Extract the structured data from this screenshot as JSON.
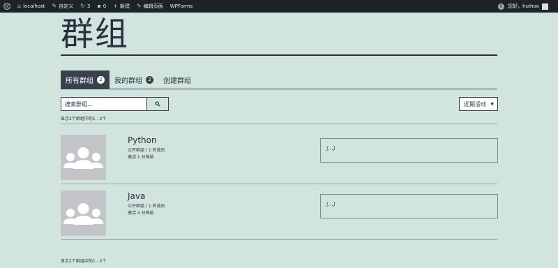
{
  "adminbar": {
    "site_name": "localhost",
    "customize": "自定义",
    "updates_count": "3",
    "comments_count": "0",
    "new": "新建",
    "edit_page": "编辑页面",
    "wpforms": "WPForms",
    "notifications": "0",
    "greeting": "您好，huihoo"
  },
  "page": {
    "title": "群组"
  },
  "tabs": [
    {
      "label": "所有群组",
      "count": "2"
    },
    {
      "label": "我的群组",
      "count": "2"
    },
    {
      "label": "创建群组"
    }
  ],
  "search": {
    "placeholder": "搜索群组..."
  },
  "order": {
    "selected": "近期活动"
  },
  "pagination": {
    "top": "显示2个群组中的1 - 2个",
    "bottom": "显示2个群组中的1 - 2个"
  },
  "groups": [
    {
      "name": "Python",
      "meta": "公开群组 / 1 名成员",
      "active": "激活 1 分钟前",
      "description": "[…]"
    },
    {
      "name": "Java",
      "meta": "公开群组 / 1 名成员",
      "active": "激活 4 分钟前",
      "description": "[…]"
    }
  ],
  "colors": {
    "background": "#d1e4dd",
    "text": "#28303d",
    "adminbar": "#1d2327",
    "active_tab": "#39414d"
  }
}
